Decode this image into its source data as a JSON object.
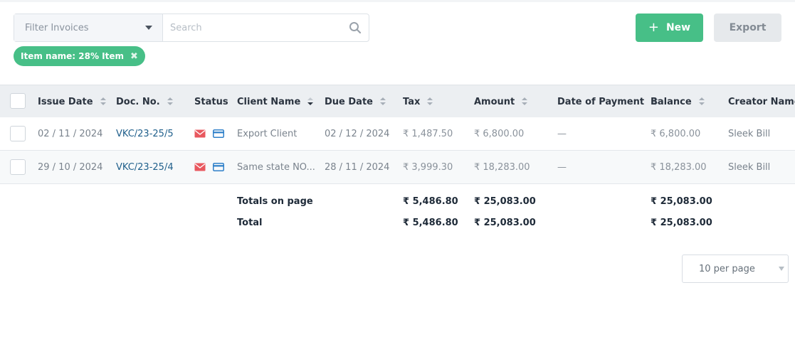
{
  "toolbar": {
    "filter_label": "Filter Invoices",
    "search_placeholder": "Search",
    "new_label": "New",
    "export_label": "Export"
  },
  "filter_chip": {
    "label": "Item name: 28% Item"
  },
  "table": {
    "columns": [
      "Issue Date",
      "Doc. No.",
      "Status",
      "Client Name",
      "Due Date",
      "Tax",
      "Amount",
      "Date of Payment",
      "Balance",
      "Creator Name"
    ],
    "rows": [
      {
        "issue_date": "02 / 11 / 2024",
        "doc_no": "VKC/23-25/5",
        "client_name": "Export Client",
        "due_date": "02 / 12 / 2024",
        "tax": "₹ 1,487.50",
        "amount": "₹ 6,800.00",
        "date_of_payment": "—",
        "balance": "₹ 6,800.00",
        "creator_name": "Sleek Bill"
      },
      {
        "issue_date": "29 / 10 / 2024",
        "doc_no": "VKC/23-25/4",
        "client_name": "Same state NO...",
        "due_date": "28 / 11 / 2024",
        "tax": "₹ 3,999.30",
        "amount": "₹ 18,283.00",
        "date_of_payment": "—",
        "balance": "₹ 18,283.00",
        "creator_name": "Sleek Bill"
      }
    ],
    "totals_on_page": {
      "label": "Totals on page",
      "tax": "₹ 5,486.80",
      "amount": "₹ 25,083.00",
      "balance": "₹ 25,083.00"
    },
    "total": {
      "label": "Total",
      "tax": "₹ 5,486.80",
      "amount": "₹ 25,083.00",
      "balance": "₹ 25,083.00"
    }
  },
  "pagination": {
    "per_page": "10 per page"
  },
  "icons": {
    "status_email": "envelope-icon",
    "status_payment": "credit-card-icon"
  },
  "colors": {
    "accent_green": "#47bf87",
    "link_blue": "#1f5f8b",
    "email_red": "#e8585f",
    "card_blue": "#2f80c9"
  }
}
